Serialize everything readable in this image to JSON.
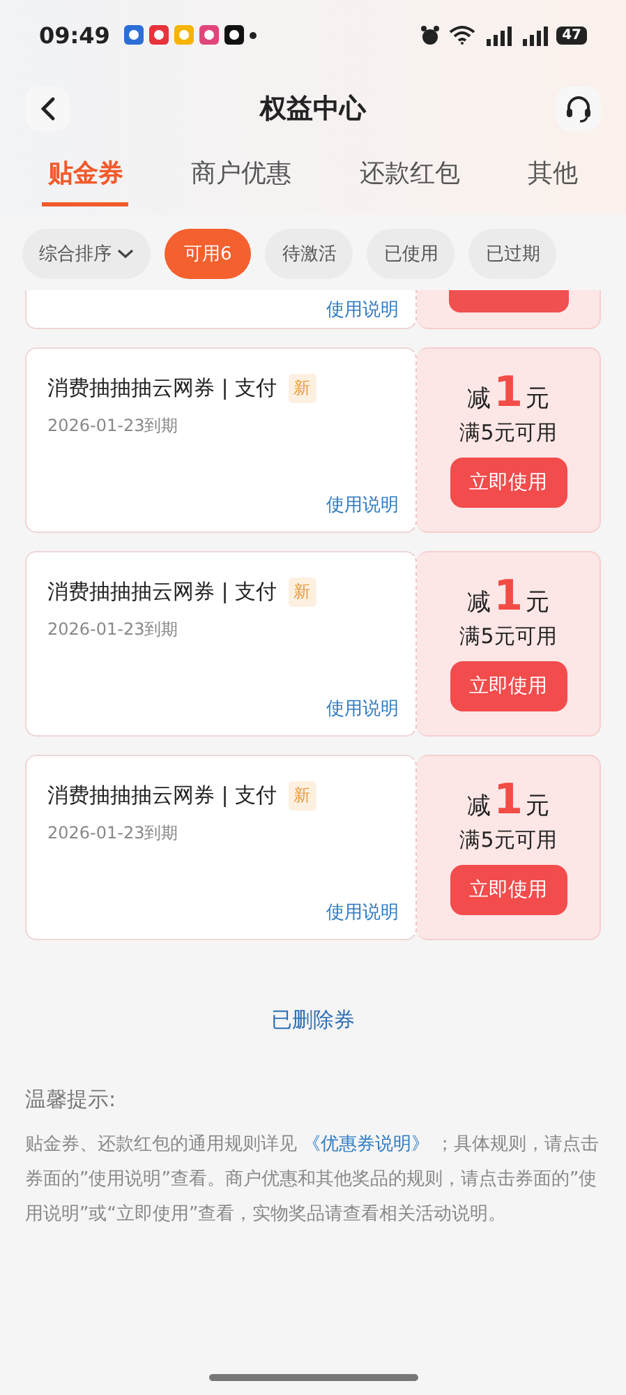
{
  "status_bar": {
    "time": "09:49",
    "battery": "47"
  },
  "header": {
    "title": "权益中心"
  },
  "tabs": [
    {
      "label": "贴金券",
      "selected": true
    },
    {
      "label": "商户优惠",
      "selected": false
    },
    {
      "label": "还款红包",
      "selected": false
    },
    {
      "label": "其他",
      "selected": false
    }
  ],
  "filters": [
    {
      "label": "综合排序",
      "kind": "dropdown",
      "selected": false
    },
    {
      "label": "可用6",
      "kind": "chip",
      "selected": true
    },
    {
      "label": "待激活",
      "kind": "chip",
      "selected": false
    },
    {
      "label": "已使用",
      "kind": "chip",
      "selected": false
    },
    {
      "label": "已过期",
      "kind": "chip",
      "selected": false
    }
  ],
  "partial_coupon": {
    "link": "使用说明"
  },
  "coupons": [
    {
      "title": "消费抽抽抽云网券 | 支付",
      "badge": "新",
      "expiry": "2026-01-23到期",
      "prefix": "减",
      "amount": "1",
      "unit": "元",
      "condition": "满5元可用",
      "button": "立即使用",
      "link": "使用说明"
    },
    {
      "title": "消费抽抽抽云网券 | 支付",
      "badge": "新",
      "expiry": "2026-01-23到期",
      "prefix": "减",
      "amount": "1",
      "unit": "元",
      "condition": "满5元可用",
      "button": "立即使用",
      "link": "使用说明"
    },
    {
      "title": "消费抽抽抽云网券 | 支付",
      "badge": "新",
      "expiry": "2026-01-23到期",
      "prefix": "减",
      "amount": "1",
      "unit": "元",
      "condition": "满5元可用",
      "button": "立即使用",
      "link": "使用说明"
    }
  ],
  "deleted_link": "已删除券",
  "notice": {
    "title": "温馨提示:",
    "before": "贴金券、还款红包的通用规则详见",
    "link": "《优惠券说明》",
    "after": "；具体规则，请点击券面的”使用说明”查看。商户优惠和其他奖品的规则，请点击券面的”使用说明”或“立即使用”查看，实物奖品请查看相关活动说明。"
  }
}
